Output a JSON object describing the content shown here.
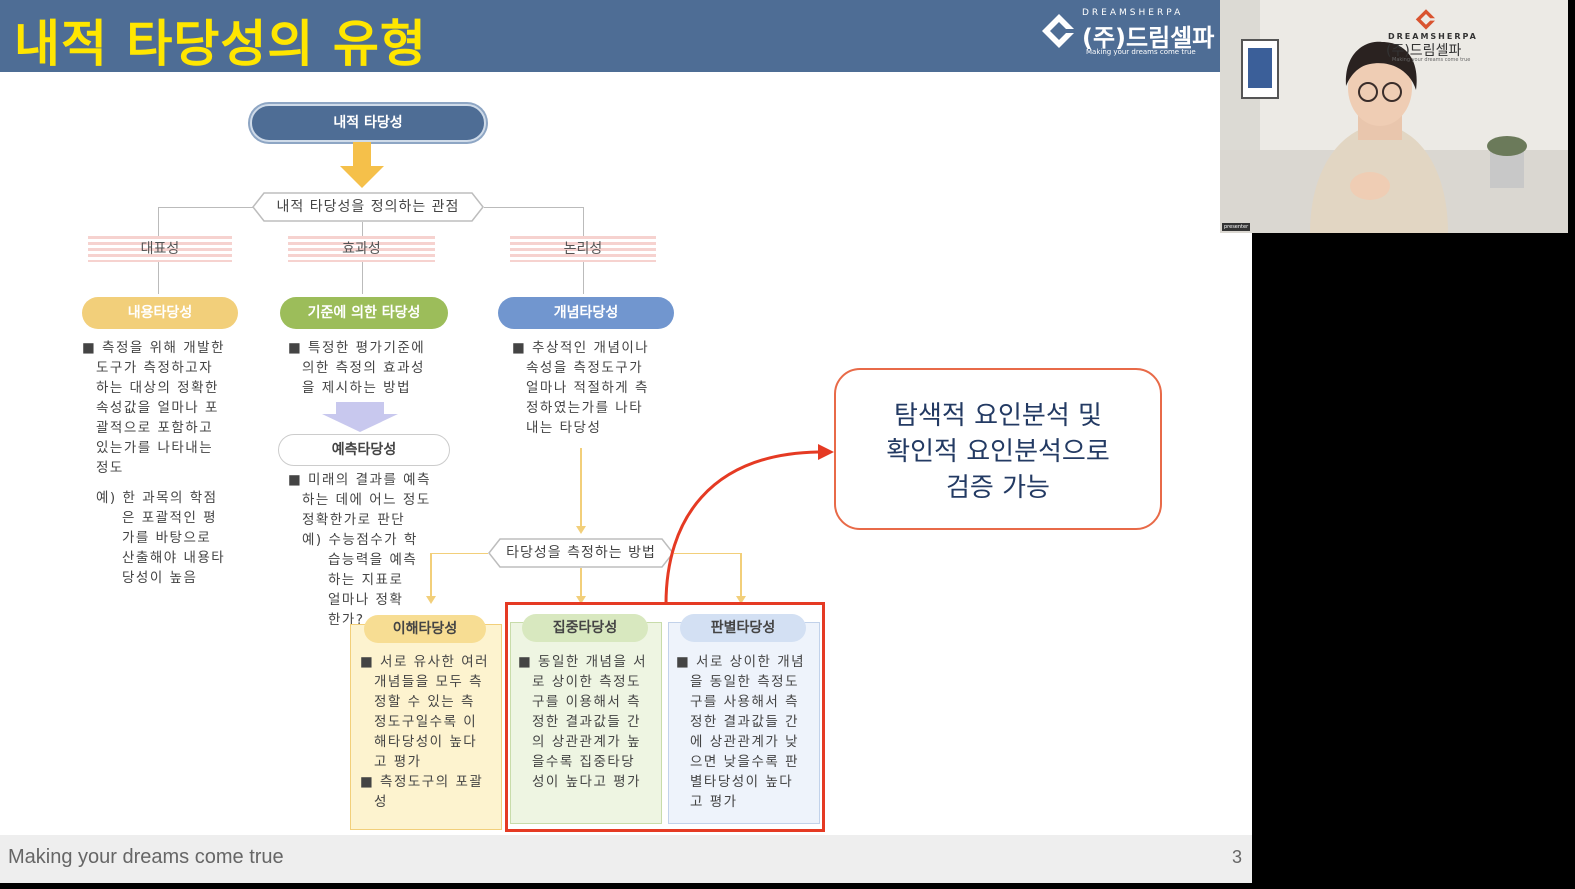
{
  "slide": {
    "title": "내적 타당성의 유형",
    "logo": {
      "brand": "DREAMSHERPA",
      "name": "(주)드림셀파",
      "tagline": "Making your dreams come true"
    },
    "footer_text": "Making your dreams come true",
    "page_number": "3"
  },
  "diagram": {
    "root": "내적 타당성",
    "perspective": "내적 타당성을 정의하는 관점",
    "categories": [
      "대표성",
      "효과성",
      "논리성"
    ],
    "types": {
      "content": {
        "label": "내용타당성",
        "lines": [
          "■ 측정을 위해 개발한",
          "도구가 측정하고자",
          "하는 대상의 정확한",
          "속성값을 얼마나 포",
          "괄적으로 포함하고",
          "있는가를 나타내는",
          "정도"
        ],
        "example": [
          "예) 한 과목의 학점",
          "은 포괄적인 평",
          "가를 바탕으로",
          "산출해야 내용타",
          "당성이 높음"
        ]
      },
      "criterion": {
        "label": "기준에 의한 타당성",
        "lines": [
          "■ 특정한 평가기준에",
          "의한 측정의 효과성",
          "을 제시하는 방법"
        ],
        "predictive": {
          "label": "예측타당성",
          "lines": [
            "■ 미래의 결과를 예측",
            "하는 데에 어느 정도",
            "정확한가로 판단"
          ],
          "example": [
            "예) 수능점수가 학",
            "습능력을 예측",
            "하는 지표로",
            "얼마나 정확",
            "한가?"
          ]
        }
      },
      "construct": {
        "label": "개념타당성",
        "lines": [
          "■ 추상적인 개념이나",
          "속성을 측정도구가",
          "얼마나 적절하게 측",
          "정하였는가를 나타",
          "내는 타당성"
        ]
      }
    },
    "method": "타당성을 측정하는 방법",
    "subtypes": {
      "comprehension": {
        "label": "이해타당성",
        "lines": [
          "■ 서로 유사한 여러",
          "개념들을 모두 측",
          "정할 수 있는 측",
          "정도구일수록 이",
          "해타당성이 높다",
          "고 평가",
          "■ 측정도구의 포괄",
          "성"
        ]
      },
      "convergent": {
        "label": "집중타당성",
        "lines": [
          "■ 동일한 개념을 서",
          "로 상이한 측정도",
          "구를 이용해서 측",
          "정한 결과값들 간",
          "의 상관관계가 높",
          "을수록 집중타당",
          "성이 높다고 평가"
        ]
      },
      "discriminant": {
        "label": "판별타당성",
        "lines": [
          "■ 서로 상이한 개념",
          "을 동일한 측정도",
          "구를 사용해서 측",
          "정한 결과값들 간",
          "에 상관관계가 낮",
          "으면 낮을수록 판",
          "별타당성이 높다",
          "고 평가"
        ]
      }
    },
    "callout": [
      "탐색적 요인분석 및",
      "확인적 요인분석으로",
      "검증 가능"
    ]
  },
  "webcam": {
    "logo": {
      "brand": "DREAMSHERPA",
      "name": "(주)드림셀파",
      "tagline": "Making your dreams come true"
    },
    "label": "presenter"
  },
  "colors": {
    "header": "#4e6d95",
    "title": "#ffe600",
    "root_pill": "#4e6d95",
    "content_pill": "#f2cf7a",
    "criterion_pill": "#9cbd5a",
    "construct_pill": "#7196cf",
    "highlight": "#e53a23"
  }
}
